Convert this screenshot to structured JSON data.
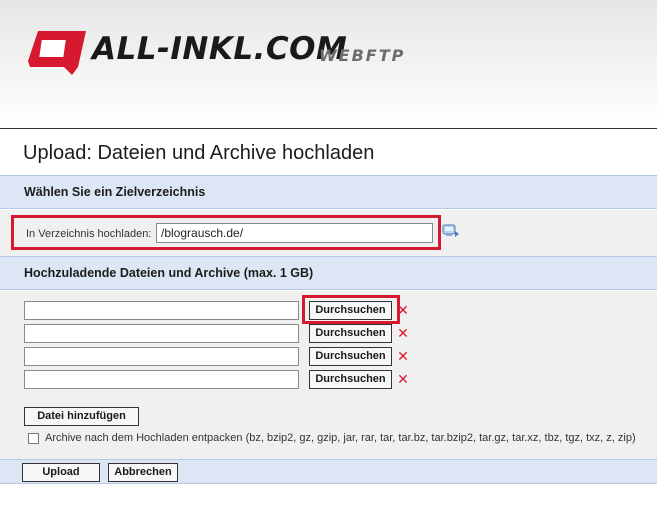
{
  "header": {
    "logo_text": "ALL-INKL.COM",
    "logo_sub": "WEBFTP",
    "logo_color": "#d7192f"
  },
  "page": {
    "title": "Upload: Dateien und Archive hochladen"
  },
  "target_section": {
    "heading": "Wählen Sie ein Zielverzeichnis",
    "dir_label": "In Verzeichnis hochladen:",
    "dir_value": "/blograusch.de/",
    "browse_icon": "folder-browse-icon"
  },
  "files_section": {
    "heading": "Hochzuladende Dateien und Archive (max. 1 GB)",
    "rows": [
      {
        "value": "",
        "browse_label": "Durchsuchen",
        "remove_icon": "remove-x-icon"
      },
      {
        "value": "",
        "browse_label": "Durchsuchen",
        "remove_icon": "remove-x-icon"
      },
      {
        "value": "",
        "browse_label": "Durchsuchen",
        "remove_icon": "remove-x-icon"
      },
      {
        "value": "",
        "browse_label": "Durchsuchen",
        "remove_icon": "remove-x-icon"
      }
    ],
    "add_file_label": "Datei hinzufügen",
    "extract_checked": false,
    "extract_label": "Archive nach dem Hochladen entpacken (bz, bzip2, gz, gzip, jar, rar, tar, tar.bz, tar.bzip2, tar.gz, tar.xz, tbz, tgz, txz, z, zip)"
  },
  "footer": {
    "upload_label": "Upload",
    "cancel_label": "Abbrechen"
  },
  "colors": {
    "highlight": "#d7192f",
    "section_bg": "#dde6f5",
    "panel_bg": "#f0f0f0"
  }
}
